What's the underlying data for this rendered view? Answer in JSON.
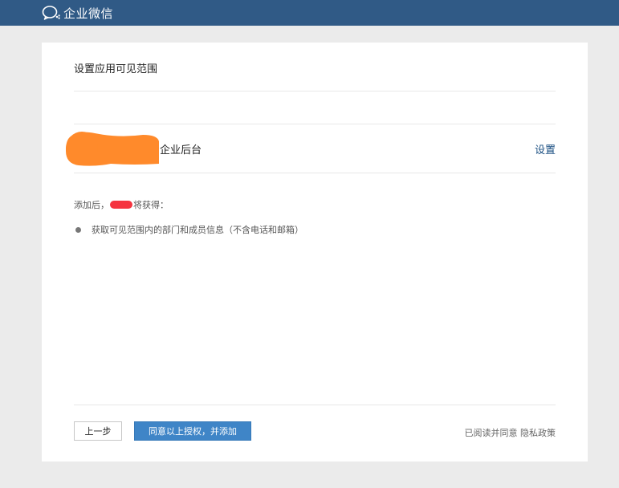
{
  "header": {
    "brand_name": "企业微信",
    "logo_icon": "wecom-chat-bubble-icon",
    "bar_color": "#305a86"
  },
  "dialog": {
    "title": "设置应用可见范围",
    "target_row": {
      "target_label": "企业后台",
      "set_label": "设置"
    },
    "permissions_intro_prefix": "添加后，",
    "permissions_intro_suffix": "将获得：",
    "permissions": [
      "获取可见范围内的部门和成员信息（不含电话和邮箱）"
    ],
    "footer": {
      "prev_label": "上一步",
      "agree_label": "同意以上授权，并添加",
      "policy_prefix": "已阅读并同意 ",
      "policy_link": "隐私政策"
    },
    "accent_color": "#3f85c7",
    "redaction_colors": [
      "#ff8a2b",
      "#f5333f"
    ]
  }
}
